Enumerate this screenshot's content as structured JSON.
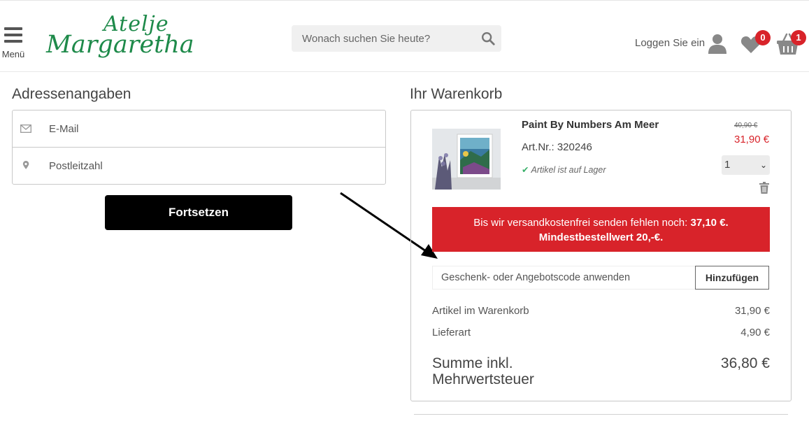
{
  "header": {
    "menu_label": "Menü",
    "logo_line1": "Atelje",
    "logo_line2": "Margaretha",
    "search_placeholder": "Wonach suchen Sie heute?",
    "login_label": "Loggen Sie ein",
    "wishlist_count": "0",
    "cart_count": "1",
    "brand_color": "#1e8a4a",
    "badge_color": "#d8232a"
  },
  "address": {
    "title": "Adressenangaben",
    "email_placeholder": "E-Mail",
    "zip_placeholder": "Postleitzahl",
    "continue_label": "Fortsetzen"
  },
  "cart": {
    "title": "Ihr Warenkorb",
    "item": {
      "name": "Paint By Numbers Am Meer",
      "article": "Art.Nr.: 320246",
      "stock": "Artikel ist auf Lager",
      "old_price": "40,90 €",
      "price": "31,90 €",
      "quantity": "1"
    },
    "shipping_notice_line1": "Bis wir versandkostenfrei senden fehlen noch:",
    "shipping_notice_amount": "37,10 €.",
    "shipping_notice_line2": "Mindestbestellwert 20,-€.",
    "code_placeholder": "Geschenk- oder Angebotscode anwenden",
    "add_label": "Hinzufügen",
    "summary": [
      {
        "label": "Artikel im Warenkorb",
        "value": "31,90 €"
      },
      {
        "label": "Lieferart",
        "value": "4,90 €"
      }
    ],
    "total_label": "Summe inkl. Mehrwertsteuer",
    "total_value": "36,80 €",
    "accent_color": "#d8232a"
  }
}
